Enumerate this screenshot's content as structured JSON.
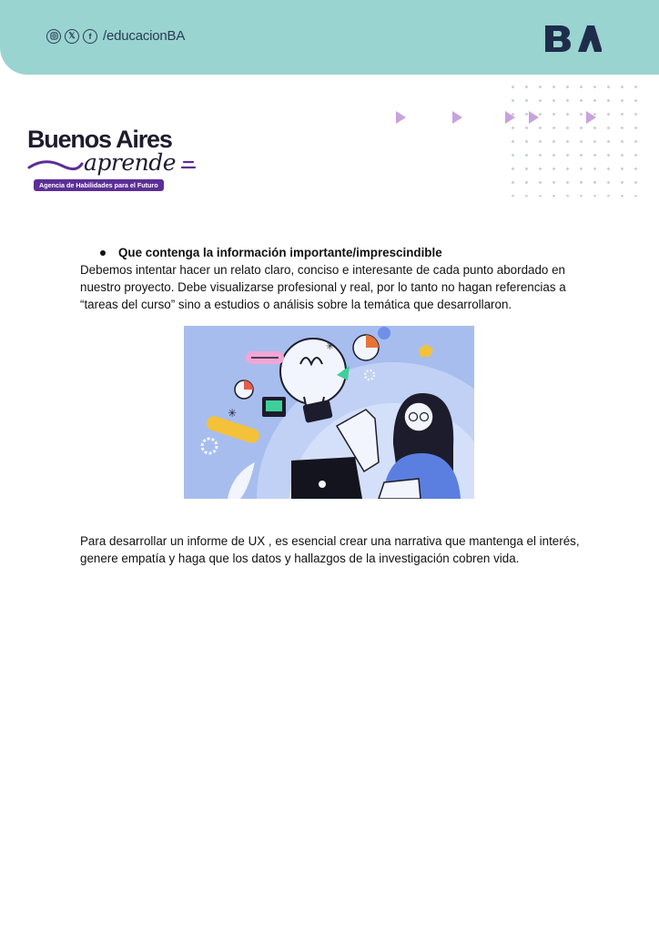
{
  "header": {
    "social_handle": "/educacionBA",
    "social_icons": [
      "instagram-icon",
      "x-icon",
      "facebook-icon"
    ],
    "logo_text": "BA",
    "bg_color": "#99d4d1"
  },
  "brand": {
    "name": "Buenos Aires",
    "script": "aprende",
    "tagline": "Agencia de Habilidades para el Futuro",
    "accent": "#5b2f96"
  },
  "content": {
    "bullet_heading": "Que contenga la información importante/imprescindible",
    "paragraph": "Debemos intentar hacer un relato claro, conciso e interesante de cada punto abordado en nuestro proyecto. Debe visualizarse profesional y real, por lo tanto no hagan referencias a “tareas del curso” sino a estudios o análisis sobre la temática que desarrollaron.",
    "closing_paragraph": "Para desarrollar un informe de UX , es esencial crear una narrativa que mantenga el interés, genere empatía y haga que los datos y hallazgos de la investigación cobren vida."
  }
}
